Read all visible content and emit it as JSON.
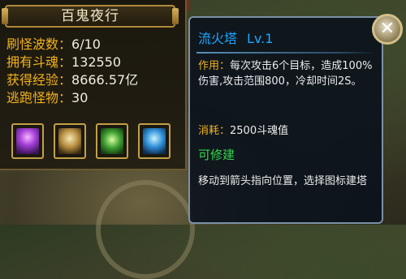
{
  "panel": {
    "title": "百鬼夜行",
    "stats": [
      {
        "label": "刷怪波数：",
        "value": "6/10"
      },
      {
        "label": "拥有斗魂：",
        "value": "132550"
      },
      {
        "label": "获得经验：",
        "value": "8666.57亿"
      },
      {
        "label": "逃跑怪物：",
        "value": "30"
      }
    ],
    "towers": [
      {
        "icon": "purple-tower-icon"
      },
      {
        "icon": "golden-tower-icon"
      },
      {
        "icon": "green-tower-icon"
      },
      {
        "icon": "blue-tower-icon"
      }
    ]
  },
  "tooltip": {
    "name": "流火塔",
    "level": "Lv.1",
    "effect_label": "作用：",
    "effect_text": "每次攻击6个目标，造成100%伤害,攻击范围800，冷却时间2S。",
    "cost_label": "消耗：",
    "cost_text": "2500斗魂值",
    "buildable": "可修建",
    "hint": "移动到箭头指向位置，选择图标建塔"
  },
  "close": {
    "icon": "close-icon",
    "glyph": "✕"
  },
  "colors": {
    "label_yellow": "#f3b21a",
    "title_blue": "#1ea7ff",
    "buildable_green": "#34d44a"
  }
}
